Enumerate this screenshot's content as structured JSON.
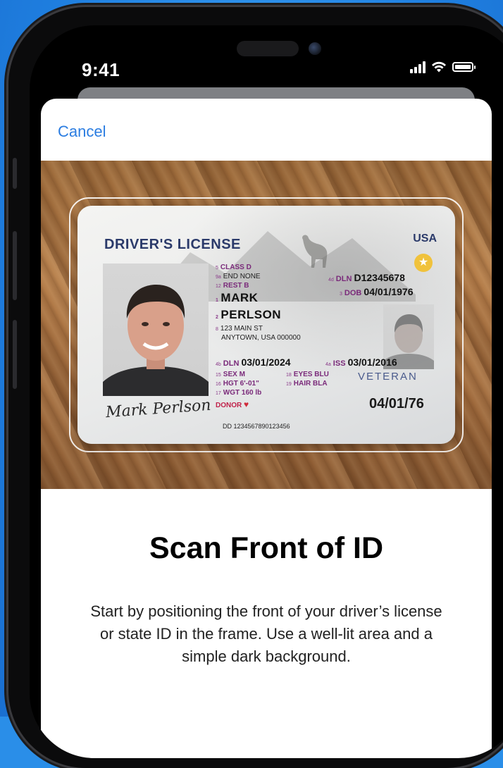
{
  "status_bar": {
    "time": "9:41"
  },
  "nav": {
    "cancel_label": "Cancel"
  },
  "license": {
    "header": "DRIVER'S LICENSE",
    "country": "USA",
    "class": "CLASS D",
    "end": "END NONE",
    "rest": "REST B",
    "first_name": "MARK",
    "last_name": "PERLSON",
    "address_line1": "123 MAIN ST",
    "address_line2": "ANYTOWN, USA 000000",
    "dln_label": "DLN",
    "dln_value": "D12345678",
    "dob_label": "DOB",
    "dob_value": "04/01/1976",
    "dln_date_label": "DLN",
    "dln_date_value": "03/01/2024",
    "iss_label": "ISS",
    "iss_value": "03/01/2016",
    "sex": "SEX M",
    "eyes": "EYES BLU",
    "hgt": "HGT 6'-01\"",
    "hair": "HAIR BLA",
    "wgt": "WGT 160 lb",
    "donor": "DONOR",
    "veteran": "VETERAN",
    "short_dob": "04/01/76",
    "dd": "DD 1234567890123456",
    "signature": "Mark Perlson"
  },
  "content": {
    "title": "Scan Front of ID",
    "description": "Start by positioning the front of your driver’s license or state ID in the frame. Use a well-lit area and a simple dark background."
  },
  "colors": {
    "accent": "#2b7de1",
    "background": "#2a8ee8"
  }
}
